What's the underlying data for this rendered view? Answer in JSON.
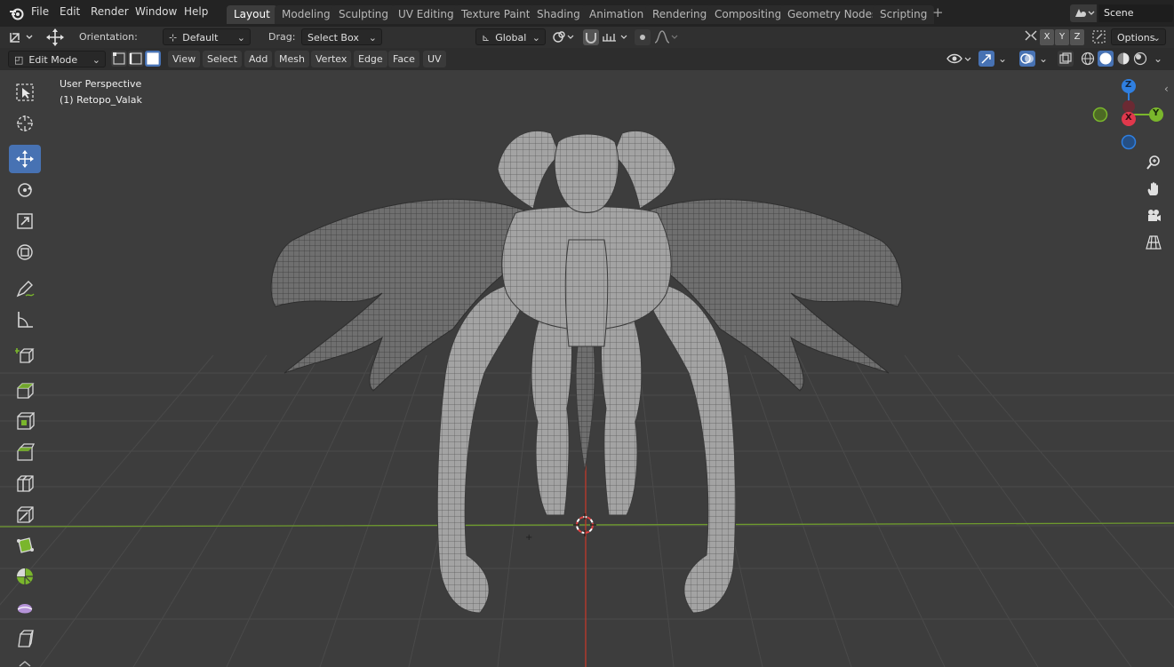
{
  "app": {
    "menus": [
      "File",
      "Edit",
      "Render",
      "Window",
      "Help"
    ],
    "scene": "Scene"
  },
  "workspaces": [
    "Layout",
    "Modeling",
    "Sculpting",
    "UV Editing",
    "Texture Paint",
    "Shading",
    "Animation",
    "Rendering",
    "Compositing",
    "Geometry Nodes",
    "Scripting"
  ],
  "active_workspace": "Layout",
  "tool_header": {
    "orientation_label": "Orientation:",
    "orientation_value": "Default",
    "drag_label": "Drag:",
    "drag_value": "Select Box",
    "transform_orientation": "Global",
    "axis_x": "X",
    "axis_y": "Y",
    "axis_z": "Z",
    "options": "Options"
  },
  "editor_header": {
    "mode": "Edit Mode",
    "menus": [
      "View",
      "Select",
      "Add",
      "Mesh",
      "Vertex",
      "Edge",
      "Face",
      "UV"
    ]
  },
  "viewport": {
    "view_name": "User Perspective",
    "object_name": "(1) Retopo_Valak"
  },
  "gizmo": {
    "x_label": "X",
    "y_label": "Y",
    "z_label": "Z"
  },
  "colors": {
    "accent": "#4772b3",
    "axis_x": "#e0384c",
    "axis_y": "#7ab62c",
    "axis_z": "#2f7fe0"
  },
  "toolbar_icons": [
    "select-box-icon",
    "cursor-icon",
    "move-icon",
    "rotate-icon",
    "scale-icon",
    "transform-icon",
    "annotate-icon",
    "measure-icon",
    "add-cube-icon",
    "extrude-icon",
    "inset-icon",
    "bevel-icon",
    "loop-cut-icon",
    "knife-icon",
    "poly-build-icon",
    "spin-icon",
    "smooth-icon",
    "shear-icon"
  ]
}
